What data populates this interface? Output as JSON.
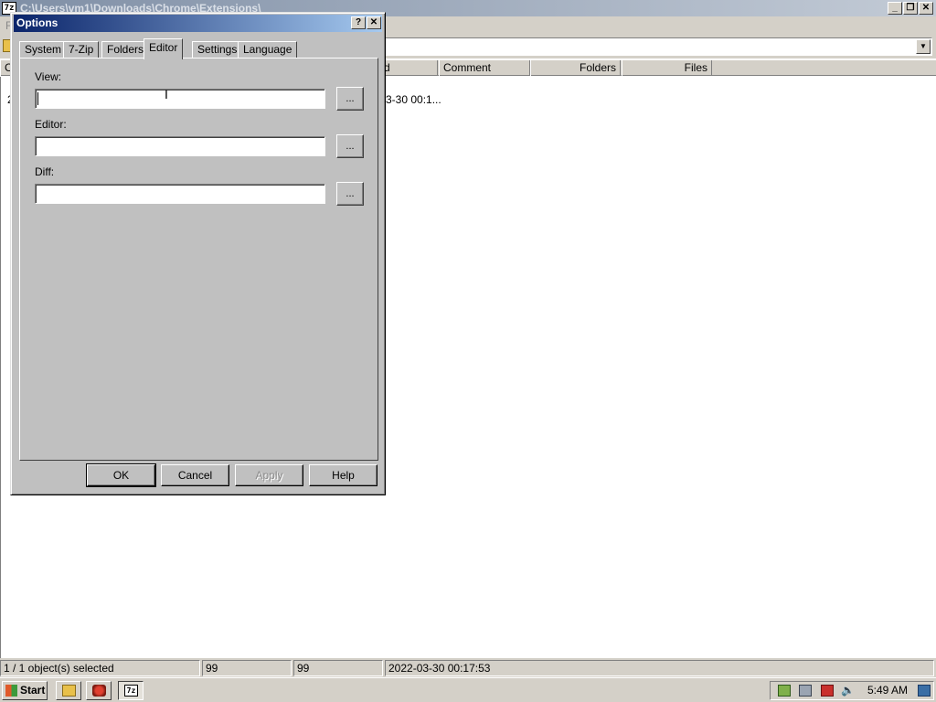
{
  "main_window": {
    "title": "C:\\Users\\vm1\\Downloads\\Chrome\\Extensions\\",
    "app_icon_text": "7z",
    "menu_first": "F",
    "columns": [
      "d",
      "Comment",
      "Folders",
      "Files"
    ],
    "column_first_partial": "C",
    "row": {
      "first_char": "2",
      "modified_partial": "3-30 00:1..."
    }
  },
  "dialog": {
    "title": "Options",
    "help_glyph": "?",
    "close_glyph": "✕",
    "tabs": [
      {
        "label": "System"
      },
      {
        "label": "7-Zip"
      },
      {
        "label": "Folders"
      },
      {
        "label": "Editor",
        "active": true
      },
      {
        "label": "Settings"
      },
      {
        "label": "Language"
      }
    ],
    "fields": {
      "view": {
        "label": "View:",
        "value": ""
      },
      "editor": {
        "label": "Editor:",
        "value": ""
      },
      "diff": {
        "label": "Diff:",
        "value": ""
      }
    },
    "browse_label": "...",
    "buttons": {
      "ok": "OK",
      "cancel": "Cancel",
      "apply": "Apply",
      "help": "Help"
    }
  },
  "status_bar": {
    "selection": "1 / 1 object(s) selected",
    "size": "99",
    "packed": "99",
    "modified": "2022-03-30 00:17:53"
  },
  "taskbar": {
    "start_label": "Start",
    "clock": "5:49 AM",
    "app_7z_label": "7z"
  }
}
